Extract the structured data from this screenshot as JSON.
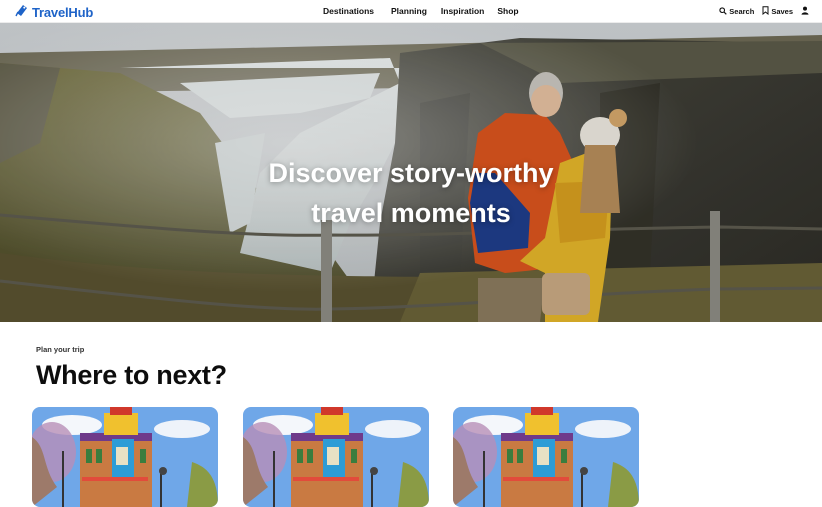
{
  "brand": {
    "name": "TravelHub",
    "logo_icon": "luggage-tag-icon"
  },
  "nav": {
    "items": [
      {
        "label": "Destinations"
      },
      {
        "label": "Planning"
      },
      {
        "label": "Inspiration"
      },
      {
        "label": "Shop"
      }
    ]
  },
  "utility": {
    "search_label": "Search",
    "saves_label": "Saves",
    "search_icon": "search-icon",
    "saves_icon": "bookmark-icon",
    "account_icon": "user-icon"
  },
  "hero": {
    "title_line1": "Discover story-worthy",
    "title_line2": "travel moments"
  },
  "section": {
    "kicker": "Plan your trip",
    "title": "Where to next?"
  },
  "cards": [
    {
      "image": "colorful-building-photo"
    },
    {
      "image": "colorful-building-photo"
    },
    {
      "image": "colorful-building-photo"
    }
  ],
  "colors": {
    "brand_blue": "#1e63c8",
    "text_dark": "#111111"
  }
}
